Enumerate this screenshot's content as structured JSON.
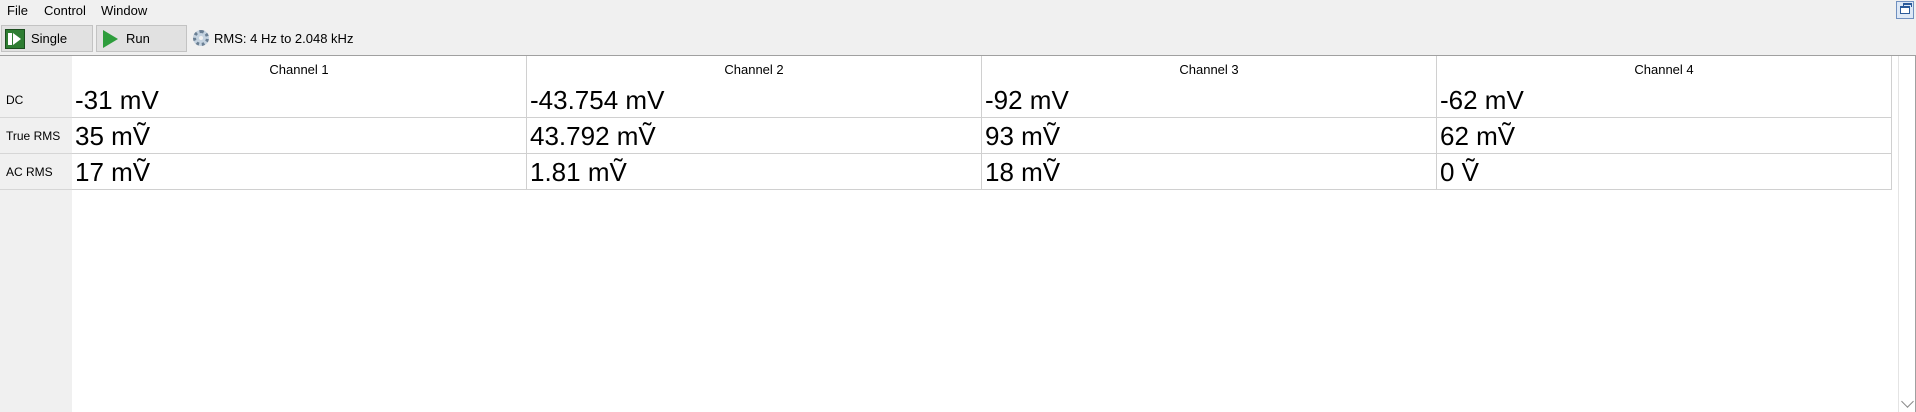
{
  "menu": {
    "file": "File",
    "control": "Control",
    "window": "Window"
  },
  "toolbar": {
    "single_label": "Single",
    "run_label": "Run",
    "rms_range": "RMS: 4 Hz to 2.048 kHz"
  },
  "table": {
    "columns": [
      "Channel 1",
      "Channel 2",
      "Channel 3",
      "Channel 4"
    ],
    "rows": [
      {
        "label": "DC",
        "values": [
          "-31 mV",
          "-43.754 mV",
          "-92 mV",
          "-62 mV"
        ]
      },
      {
        "label": "True RMS",
        "values": [
          "35 mṼ",
          "43.792 mṼ",
          "93 mṼ",
          "62 mṼ"
        ]
      },
      {
        "label": "AC RMS",
        "values": [
          "17 mṼ",
          "1.81 mṼ",
          "18 mṼ",
          "0 Ṽ"
        ]
      }
    ]
  }
}
